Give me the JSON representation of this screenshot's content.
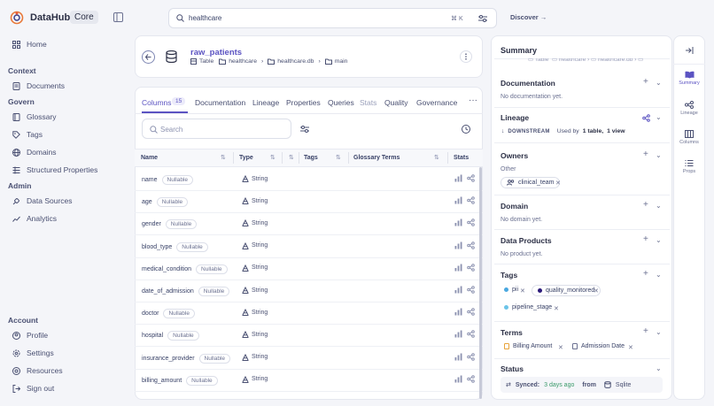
{
  "app": {
    "title": "DataHub",
    "badge": "Core"
  },
  "search": {
    "value": "healthcare",
    "shortcut": "⌘ K",
    "discover_label": "Discover →"
  },
  "sidebar": {
    "home": "Home",
    "sections": [
      {
        "title": "Context",
        "items": [
          "Documents"
        ]
      },
      {
        "title": "Govern",
        "items": [
          "Glossary",
          "Tags",
          "Domains",
          "Structured Properties"
        ]
      },
      {
        "title": "Admin",
        "items": [
          "Data Sources",
          "Analytics"
        ]
      },
      {
        "title": "Account",
        "items": [
          "Profile",
          "Settings",
          "Resources",
          "Sign out"
        ]
      }
    ]
  },
  "entity": {
    "name": "raw_patients",
    "type": "Table",
    "breadcrumb": [
      "healthcare",
      "healthcare.db",
      "main"
    ]
  },
  "tabs": [
    {
      "label": "Columns",
      "count": "15",
      "active": true
    },
    {
      "label": "Documentation"
    },
    {
      "label": "Lineage"
    },
    {
      "label": "Properties"
    },
    {
      "label": "Queries"
    },
    {
      "label": "Stats",
      "disabled": true
    },
    {
      "label": "Quality"
    },
    {
      "label": "Governance"
    }
  ],
  "column_search": {
    "placeholder": "Search"
  },
  "table": {
    "headers": [
      "Name",
      "Type",
      "Tags",
      "Glossary Terms",
      "Stats"
    ],
    "rows": [
      {
        "name": "name",
        "nullable": "Nullable",
        "type": "String"
      },
      {
        "name": "age",
        "nullable": "Nullable",
        "type": "String"
      },
      {
        "name": "gender",
        "nullable": "Nullable",
        "type": "String"
      },
      {
        "name": "blood_type",
        "nullable": "Nullable",
        "type": "String"
      },
      {
        "name": "medical_condition",
        "nullable": "Nullable",
        "type": "String"
      },
      {
        "name": "date_of_admission",
        "nullable": "Nullable",
        "type": "String"
      },
      {
        "name": "doctor",
        "nullable": "Nullable",
        "type": "String"
      },
      {
        "name": "hospital",
        "nullable": "Nullable",
        "type": "String"
      },
      {
        "name": "insurance_provider",
        "nullable": "Nullable",
        "type": "String"
      },
      {
        "name": "billing_amount",
        "nullable": "Nullable",
        "type": "String"
      }
    ]
  },
  "summary": {
    "title": "Summary",
    "documentation": {
      "title": "Documentation",
      "empty": "No documentation yet."
    },
    "lineage": {
      "title": "Lineage",
      "direction": "DOWNSTREAM",
      "used_by_prefix": "Used by",
      "tables": "1 table,",
      "views": "1 view"
    },
    "owners": {
      "title": "Owners",
      "group": "Other",
      "owner": "clinical_team"
    },
    "domain": {
      "title": "Domain",
      "empty": "No domain yet."
    },
    "data_products": {
      "title": "Data Products",
      "empty": "No product yet."
    },
    "tags": {
      "title": "Tags",
      "items": [
        {
          "label": "pii",
          "color": "#4aa8e0"
        },
        {
          "label": "quality_monitored",
          "color": "#2b1a7a"
        },
        {
          "label": "pipeline_stage",
          "color": "#6cc4e8"
        }
      ]
    },
    "terms": {
      "title": "Terms",
      "items": [
        "Billing Amount",
        "Admission Date"
      ]
    },
    "status": {
      "title": "Status",
      "synced_label": "Synced:",
      "synced_time": "3 days ago",
      "from": "from",
      "source": "Sqlite"
    }
  },
  "rail": [
    "Summary",
    "Lineage",
    "Columns",
    "Props"
  ],
  "colors": {
    "accent": "#5b53c2",
    "synced": "#3a9a6a"
  }
}
